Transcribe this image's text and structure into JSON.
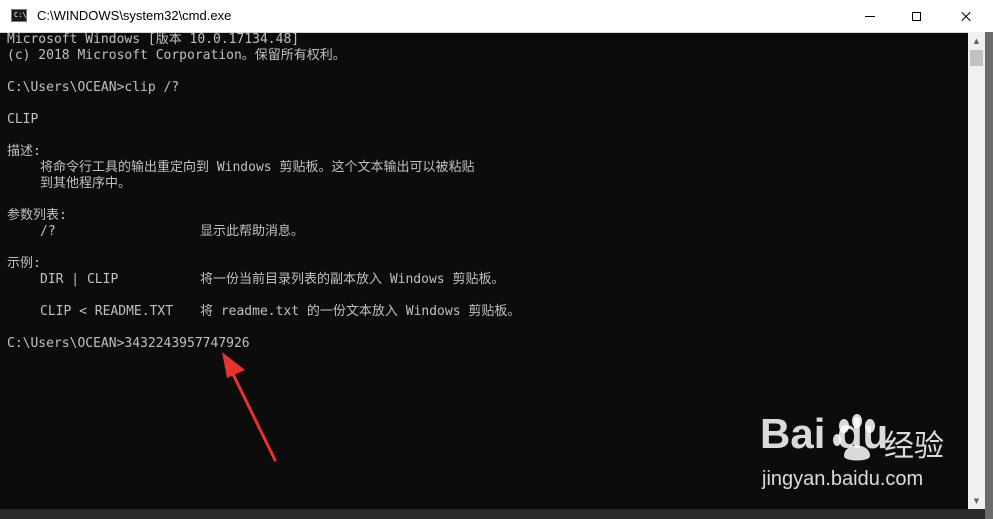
{
  "window": {
    "title": "C:\\WINDOWS\\system32\\cmd.exe",
    "app_icon_text": "C:\\",
    "controls": {
      "minimize": "minimize-icon",
      "maximize": "maximize-icon",
      "close": "close-icon"
    }
  },
  "console": {
    "banner_line1": "Microsoft Windows [版本 10.0.17134.48]",
    "banner_line2": "(c) 2018 Microsoft Corporation。保留所有权利。",
    "command_line": "C:\\Users\\OCEAN>clip /?",
    "help_title": "CLIP",
    "description_header": "描述:",
    "description_line1": "将命令行工具的输出重定向到 Windows 剪贴板。这个文本输出可以被粘贴",
    "description_line2": "到其他程序中。",
    "params_header": "参数列表:",
    "params": [
      {
        "flag": "/?",
        "desc": "显示此帮助消息。"
      }
    ],
    "examples_header": "示例:",
    "examples": [
      {
        "cmd": "DIR | CLIP",
        "desc": "将一份当前目录列表的副本放入 Windows 剪贴板。"
      },
      {
        "cmd": "CLIP < README.TXT",
        "desc": "将 readme.txt 的一份文本放入 Windows 剪贴板。"
      }
    ],
    "prompt_line": "C:\\Users\\OCEAN>3432243957747926"
  },
  "scrollbar": {
    "up_icon": "scroll-up-arrow-icon",
    "down_icon": "scroll-down-arrow-icon"
  },
  "watermark": {
    "logo_text": "Bai du",
    "logo_cn": "经验",
    "url": "jingyan.baidu.com"
  },
  "colors": {
    "console_bg": "#0c0c0c",
    "console_text": "#c0c0c0",
    "titlebar_bg": "#ffffff",
    "annotation_arrow": "#e8322f"
  }
}
